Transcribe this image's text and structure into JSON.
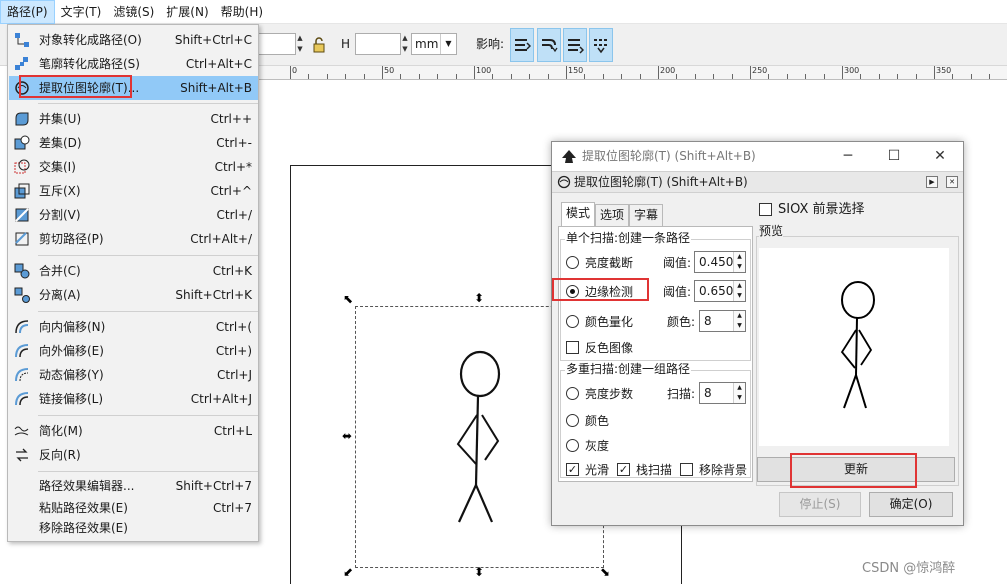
{
  "menubar": {
    "items": [
      "路径(P)",
      "文字(T)",
      "滤镜(S)",
      "扩展(N)",
      "帮助(H)"
    ]
  },
  "toolbar": {
    "h_label": "H",
    "unit": "mm",
    "affect_label": "影响:"
  },
  "ruler": {
    "labels": [
      "0",
      "50",
      "100",
      "150",
      "200",
      "250",
      "300",
      "350"
    ]
  },
  "path_menu": {
    "items": [
      {
        "label": "对象转化成路径(O)",
        "shortcut": "Shift+Ctrl+C",
        "icon": "object-to-path-icon"
      },
      {
        "label": "笔廓转化成路径(S)",
        "shortcut": "Ctrl+Alt+C",
        "icon": "stroke-to-path-icon"
      },
      {
        "label": "提取位图轮廓(T)...",
        "shortcut": "Shift+Alt+B",
        "icon": "trace-bitmap-icon"
      },
      {
        "label": "并集(U)",
        "shortcut": "Ctrl++",
        "icon": "union-icon"
      },
      {
        "label": "差集(D)",
        "shortcut": "Ctrl+-",
        "icon": "difference-icon"
      },
      {
        "label": "交集(I)",
        "shortcut": "Ctrl+*",
        "icon": "intersection-icon"
      },
      {
        "label": "互斥(X)",
        "shortcut": "Ctrl+^",
        "icon": "exclusion-icon"
      },
      {
        "label": "分割(V)",
        "shortcut": "Ctrl+/",
        "icon": "division-icon"
      },
      {
        "label": "剪切路径(P)",
        "shortcut": "Ctrl+Alt+/",
        "icon": "cut-path-icon"
      },
      {
        "label": "合并(C)",
        "shortcut": "Ctrl+K",
        "icon": "combine-icon"
      },
      {
        "label": "分离(A)",
        "shortcut": "Shift+Ctrl+K",
        "icon": "break-apart-icon"
      },
      {
        "label": "向内偏移(N)",
        "shortcut": "Ctrl+(",
        "icon": "inset-icon"
      },
      {
        "label": "向外偏移(E)",
        "shortcut": "Ctrl+)",
        "icon": "outset-icon"
      },
      {
        "label": "动态偏移(Y)",
        "shortcut": "Ctrl+J",
        "icon": "dynamic-offset-icon"
      },
      {
        "label": "链接偏移(L)",
        "shortcut": "Ctrl+Alt+J",
        "icon": "linked-offset-icon"
      },
      {
        "label": "简化(M)",
        "shortcut": "Ctrl+L",
        "icon": "simplify-icon"
      },
      {
        "label": "反向(R)",
        "shortcut": "",
        "icon": "reverse-icon"
      },
      {
        "label": "路径效果编辑器...",
        "shortcut": "Shift+Ctrl+7",
        "icon": ""
      },
      {
        "label": "粘贴路径效果(E)",
        "shortcut": "Ctrl+7",
        "icon": ""
      },
      {
        "label": "移除路径效果(E)",
        "shortcut": "",
        "icon": ""
      }
    ]
  },
  "dialog": {
    "window_title": "提取位图轮廓(T) (Shift+Alt+B)",
    "dock_title": "提取位图轮廓(T) (Shift+Alt+B)",
    "tabs": [
      "模式",
      "选项",
      "字幕"
    ],
    "single_scan": {
      "title": "单个扫描:创建一条路径",
      "brightness": {
        "label": "亮度截断",
        "param": "阈值:",
        "value": "0.450"
      },
      "edge": {
        "label": "边缘检测",
        "param": "阈值:",
        "value": "0.650"
      },
      "quant": {
        "label": "颜色量化",
        "param": "颜色:",
        "value": "8"
      },
      "invert": "反色图像"
    },
    "multi_scan": {
      "title": "多重扫描:创建一组路径",
      "steps": {
        "label": "亮度步数",
        "param": "扫描:",
        "value": "8"
      },
      "colors": "颜色",
      "grays": "灰度",
      "smooth": "光滑",
      "stack": "栈扫描",
      "remove_bg": "移除背景"
    },
    "siox": "SIOX 前景选择",
    "preview_label": "预览",
    "update_btn": "更新",
    "stop_btn": "停止(S)",
    "ok_btn": "确定(O)"
  },
  "watermark": "CSDN @惊鸿醉"
}
